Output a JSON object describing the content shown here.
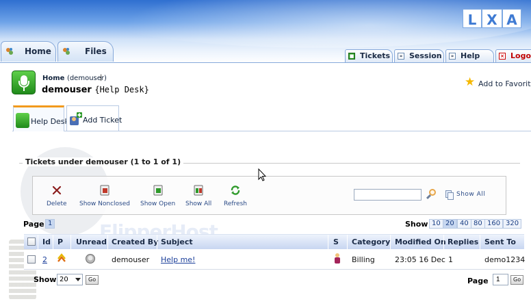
{
  "header": {
    "logo_letters": [
      "L",
      "X",
      "A"
    ],
    "main_tabs": [
      {
        "label": "Home"
      },
      {
        "label": "Files"
      }
    ],
    "right_tabs": [
      {
        "label": "Tickets",
        "icon": "ticket-icon"
      },
      {
        "label": "Session",
        "icon": "session-icon"
      },
      {
        "label": "Help",
        "icon": "help-icon"
      },
      {
        "label": "Logout",
        "icon": "logout-icon"
      }
    ]
  },
  "page": {
    "breadcrumb_home": "Home",
    "breadcrumb_user": "(demouser)",
    "breadcrumb_sep": "|",
    "title_user": "demouser",
    "title_module": "{Help Desk}",
    "add_to_favorites": "Add to Favorites"
  },
  "subtabs": [
    {
      "label": "Help Desk",
      "active": true
    },
    {
      "label": "Add Ticket",
      "active": false
    }
  ],
  "section": {
    "title": "Tickets under demouser (1 to 1 of 1)"
  },
  "toolbar": {
    "delete": "Delete",
    "show_nonclosed": "Show Nonclosed",
    "show_open": "Show Open",
    "show_all_btn": "Show All",
    "refresh": "Refresh",
    "search_value": "",
    "show_all_link": "Show All"
  },
  "paging_top": {
    "page_label": "Page",
    "current_page": "1",
    "show_label": "Show",
    "sizes": [
      "10",
      "20",
      "40",
      "80",
      "160",
      "320"
    ],
    "selected_size": "20"
  },
  "table": {
    "headers": [
      "Id",
      "P",
      "Unread",
      "Created By",
      "Subject",
      "S",
      "Category",
      "Modified On",
      "Replies",
      "Sent To"
    ],
    "rows": [
      {
        "id": "2",
        "created_by": "demouser",
        "subject": "Help me!",
        "category": "Billing",
        "modified_on": "23:05 16 Dec",
        "replies": "1",
        "sent_to": "demo1234"
      }
    ]
  },
  "paging_bottom": {
    "show_label": "Show",
    "show_value": "20",
    "go_label": "Go",
    "page_label": "Page",
    "page_value": "1",
    "go_label_2": "Go"
  },
  "watermark": {
    "text": "FlipperHost"
  },
  "colors": {
    "accent_tab": "#f29a1c",
    "link": "#1b3f9a",
    "header_blue": "#2f6fd0"
  }
}
